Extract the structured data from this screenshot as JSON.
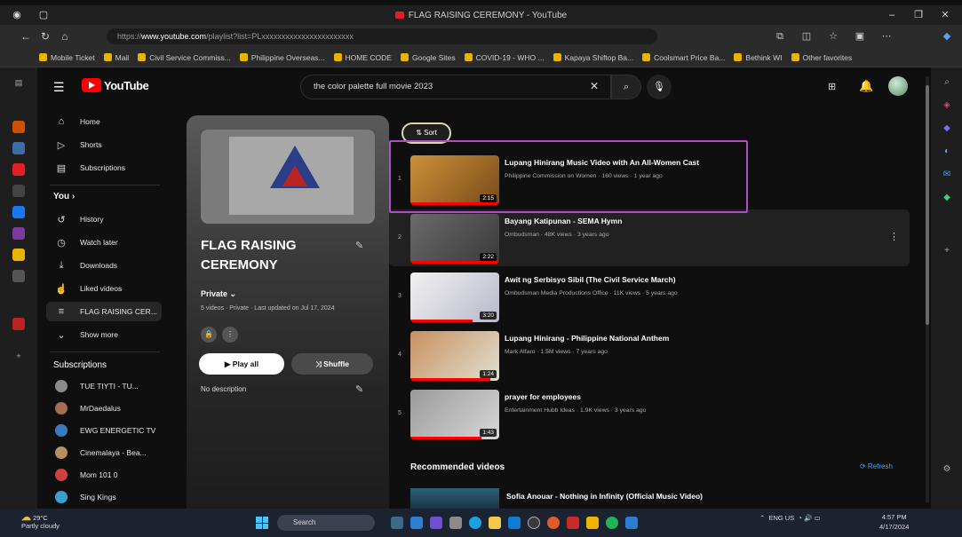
{
  "browser": {
    "tab_title": "FLAG RAISING CEREMONY - YouTube",
    "url_prefix": "https://",
    "url_domain": "www.youtube.com",
    "url_rest": "/playlist?list=PLxxxxxxxxxxxxxxxxxxxxxxx"
  },
  "bookmarks": [
    "Mobile Ticket",
    "Mail",
    "Civil Service Commiss...",
    "Philippine Overseas...",
    "HOME CODE",
    "Google Sites",
    "COVID-19 - WHO ...",
    "Kapaya Shiftop Ba...",
    "Coolsmart Price Ba...",
    "Bethink WI",
    "Other favorites"
  ],
  "youtube": {
    "logo_text": "YouTube",
    "search_query": "the color palette full movie 2023",
    "colors": {
      "accent": "#ff0000",
      "link": "#3ea6ff",
      "highlight": "#b04cc4"
    }
  },
  "sidebar": {
    "top": [
      {
        "icon": "home-icon",
        "glyph": "⌂",
        "label": "Home"
      },
      {
        "icon": "shorts-icon",
        "glyph": "▷",
        "label": "Shorts"
      },
      {
        "icon": "subscriptions-icon",
        "glyph": "▤",
        "label": "Subscriptions"
      }
    ],
    "you_heading": "You  ›",
    "you": [
      {
        "icon": "history-icon",
        "glyph": "↺",
        "label": "History"
      },
      {
        "icon": "watch-later-icon",
        "glyph": "◷",
        "label": "Watch later"
      },
      {
        "icon": "downloads-icon",
        "glyph": "⤓",
        "label": "Downloads"
      },
      {
        "icon": "liked-icon",
        "glyph": "☝",
        "label": "Liked videos"
      },
      {
        "icon": "playlist-icon",
        "glyph": "≡",
        "label": "FLAG RAISING CER..."
      },
      {
        "icon": "show-more-icon",
        "glyph": "⌄",
        "label": "Show more"
      }
    ],
    "subs_heading": "Subscriptions",
    "subs": [
      {
        "label": "TUE TIYTI - TU...",
        "color": "#8a8a8a"
      },
      {
        "label": "MrDaedalus",
        "color": "#a07050"
      },
      {
        "label": "EWG ENERGETIC TV",
        "color": "#3a7abf"
      },
      {
        "label": "Cinemalaya - Bea...",
        "color": "#b89060"
      },
      {
        "label": "Mom 101 0",
        "color": "#d04040"
      },
      {
        "label": "Sing Kings",
        "color": "#3aa0d0"
      }
    ]
  },
  "playlist": {
    "title": "FLAG RAISING CEREMONY",
    "owner": "Private  ⌄",
    "meta": "5 videos · Private · Last updated on Jul 17, 2024",
    "play_all": "▶  Play all",
    "shuffle": "⤨  Shuffle",
    "description": "No description"
  },
  "sort_label": "⇅  Sort",
  "videos": [
    {
      "index": "1",
      "title": "Lupang Hinirang Music Video with An All-Women Cast",
      "meta": "Philippine Commission on Women · 160 views · 1 year ago",
      "duration": "2:15",
      "thumb": [
        "#c9913a",
        "#7a4a18"
      ],
      "progress": 1.0
    },
    {
      "index": "2",
      "title": "Bayang Katipunan - SEMA Hymn",
      "meta": "Ombudsman · 48K views · 3 years ago",
      "duration": "2:22",
      "thumb": [
        "#6a6a6a",
        "#3a3a3a"
      ],
      "progress": 1.0
    },
    {
      "index": "3",
      "title": "Awit ng Serbisyo Sibil (The Civil Service March)",
      "meta": "Ombudsman Media Productions Office · 11K views · 5 years ago",
      "duration": "3:20",
      "thumb": [
        "#f2f2f2",
        "#b8b8c8"
      ],
      "progress": 0.7
    },
    {
      "index": "4",
      "title": "Lupang Hinirang - Philippine National Anthem",
      "meta": "Mark Alfaro · 1.5M views · 7 years ago",
      "duration": "1:24",
      "thumb": [
        "#c89060",
        "#e0e0d0"
      ],
      "progress": 0.9
    },
    {
      "index": "5",
      "title": "prayer for employees",
      "meta": "Entertainment Hubb Ideas · 1.9K views · 3 years ago",
      "duration": "1:43",
      "thumb": [
        "#9a9a9a",
        "#d8d8d8"
      ],
      "progress": 0.8
    }
  ],
  "recommended": {
    "heading": "Recommended videos",
    "refresh": "⟳  Refresh",
    "first_title": "Sofia Anouar - Nothing in Infinity (Official Music Video)"
  },
  "taskbar": {
    "weather_temp": "29°C",
    "weather_text": "Partly cloudy",
    "search": "Search",
    "tray_lang": "ENG US",
    "time": "4:57 PM",
    "date": "4/17/2024"
  }
}
